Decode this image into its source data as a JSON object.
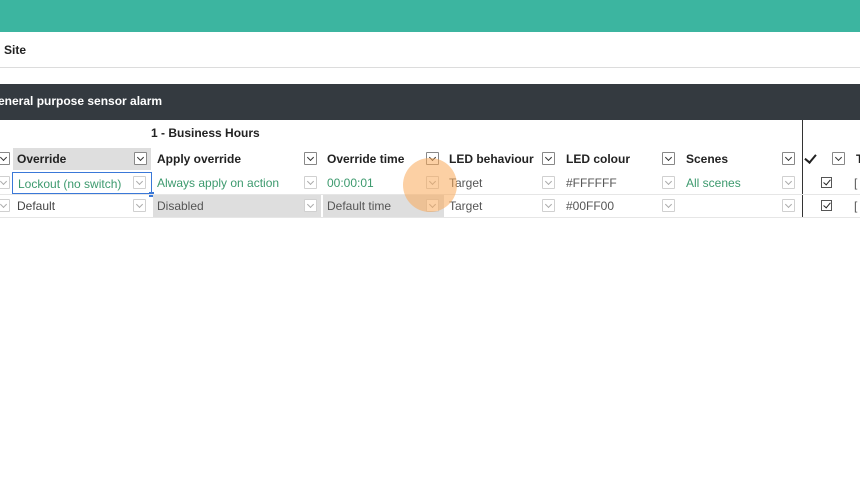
{
  "nav": {
    "site_label": "Site"
  },
  "section": {
    "title": "eneral purpose sensor alarm"
  },
  "schedule": {
    "label": "1 - Business Hours"
  },
  "columns": {
    "override": "Override",
    "apply_override": "Apply override",
    "override_time": "Override time",
    "led_behaviour": "LED behaviour",
    "led_colour": "LED colour",
    "scenes": "Scenes",
    "partial_t": "T"
  },
  "rows": [
    {
      "override": "Lockout (no switch)",
      "apply_override": "Always apply on action",
      "override_time": "00:00:01",
      "led_behaviour": "Target",
      "led_colour": "#FFFFFF",
      "scenes": "All scenes",
      "checked": true,
      "partial": "["
    },
    {
      "override": "Default",
      "apply_override": "Disabled",
      "override_time": "Default time",
      "led_behaviour": "Target",
      "led_colour": "#00FF00",
      "scenes": "",
      "checked": true,
      "partial": "["
    }
  ],
  "colors": {
    "accent": "#3cb5a0",
    "section_bar": "#343a40",
    "selection": "#3a78d8",
    "value_text": "#3d9a6e"
  },
  "cursor_highlight": "orange-circle"
}
